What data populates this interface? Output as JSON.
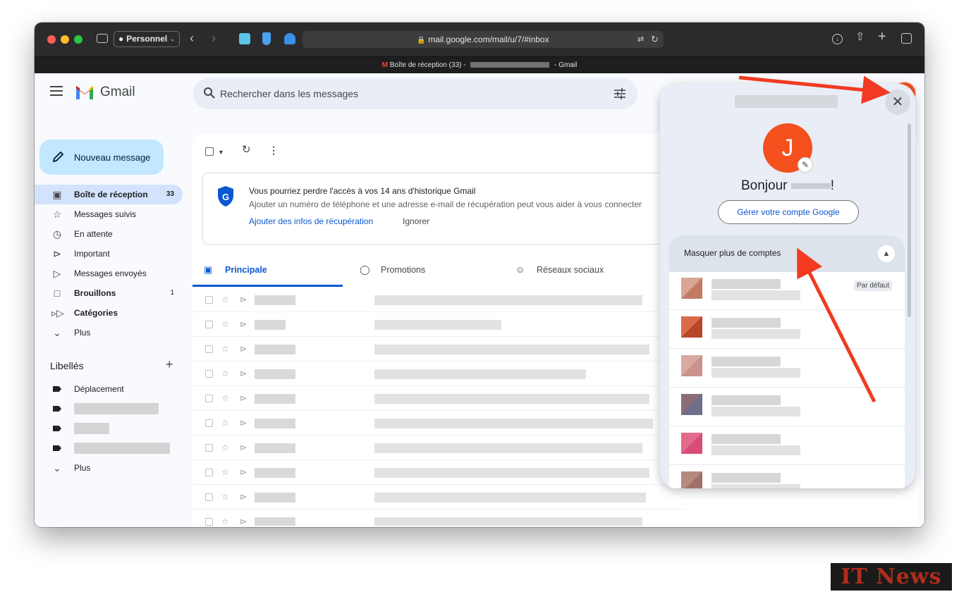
{
  "browser": {
    "profile_label": "Personnel",
    "url": "mail.google.com/mail/u/7/#inbox",
    "tab_title_prefix": "Boîte de réception (33) -",
    "tab_title_suffix": "- Gmail"
  },
  "header": {
    "app_name": "Gmail",
    "search_placeholder": "Rechercher dans les messages",
    "avatar_letter": "J"
  },
  "sidebar": {
    "compose_label": "Nouveau message",
    "items": [
      {
        "label": "Boîte de réception",
        "count": "33",
        "icon": "inbox-icon"
      },
      {
        "label": "Messages suivis",
        "count": "",
        "icon": "star-icon"
      },
      {
        "label": "En attente",
        "count": "",
        "icon": "clock-icon"
      },
      {
        "label": "Important",
        "count": "",
        "icon": "important-icon"
      },
      {
        "label": "Messages envoyés",
        "count": "",
        "icon": "send-icon"
      },
      {
        "label": "Brouillons",
        "count": "1",
        "icon": "draft-icon"
      },
      {
        "label": "Catégories",
        "count": "",
        "icon": "label-icon"
      },
      {
        "label": "Plus",
        "count": "",
        "icon": "chevron-down-icon"
      }
    ],
    "labels_heading": "Libellés",
    "labels": [
      {
        "label": "Déplacement"
      }
    ],
    "labels_more": "Plus"
  },
  "banner": {
    "title": "Vous pourriez perdre l'accès à vos 14 ans d'historique Gmail",
    "text": "Ajouter un numéro de téléphone et une adresse e-mail de récupération peut vous aider à vous connecter",
    "link": "Ajouter des infos de récupération",
    "ignore": "Ignorer"
  },
  "tabs": [
    {
      "label": "Principale",
      "icon": "inbox-tab-icon"
    },
    {
      "label": "Promotions",
      "icon": "tag-icon"
    },
    {
      "label": "Réseaux sociaux",
      "icon": "people-icon"
    }
  ],
  "account_panel": {
    "avatar_letter": "J",
    "greeting_prefix": "Bonjour",
    "greeting_suffix": "!",
    "manage_label": "Gérer votre compte Google",
    "accounts_heading": "Masquer plus de comptes",
    "default_badge": "Par défaut"
  },
  "watermark": "IT News",
  "colors": {
    "accent_blue": "#0b57d0",
    "avatar_orange": "#f4511e",
    "compose_blue": "#c2e7ff",
    "arrow_red": "#f23a22"
  }
}
